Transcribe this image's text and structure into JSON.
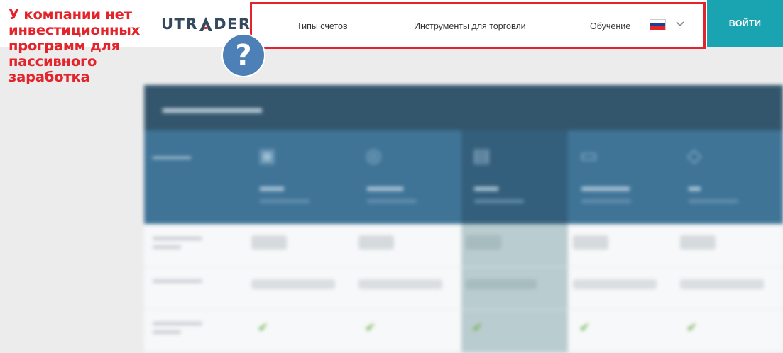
{
  "annotation": {
    "text": "У компании нет инвестиционных программ для пассивного заработка",
    "badge": "?"
  },
  "header": {
    "logo": "UTRADER",
    "nav": [
      {
        "label": "Типы счетов"
      },
      {
        "label": "Инструменты для торговли"
      },
      {
        "label": "Обучение"
      }
    ],
    "language_flag": "russia-flag",
    "login_label": "ВОЙТИ"
  },
  "colors": {
    "annotation": "#e3242b",
    "login_button": "#1aa3b0",
    "table_title_bar": "#34566c",
    "table_header": "#3f7497",
    "badge": "#4c80b6"
  }
}
